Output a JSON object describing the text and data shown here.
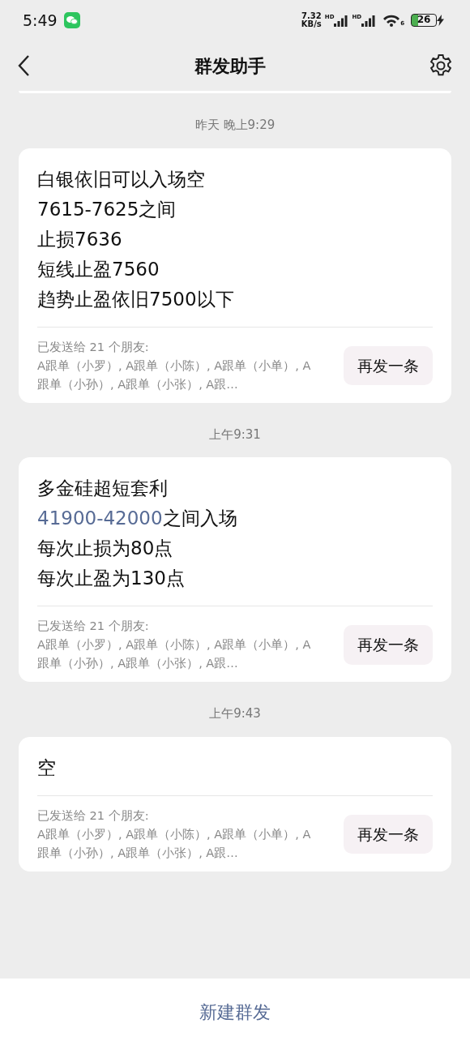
{
  "status_bar": {
    "time": "5:49",
    "speed_value": "7.32",
    "speed_unit": "KB/s",
    "sim_labels": [
      "HD",
      "HD"
    ],
    "wifi_label": "6",
    "battery": "26"
  },
  "header": {
    "title": "群发助手"
  },
  "messages": [
    {
      "time": "昨天 晚上9:29",
      "lines": [
        {
          "text": "白银依旧可以入场空"
        },
        {
          "text": "7615-7625之间"
        },
        {
          "text": "止损7636"
        },
        {
          "text": "短线止盈7560"
        },
        {
          "text": "趋势止盈依旧7500以下"
        }
      ],
      "sent_label": "已发送给 21 个朋友:",
      "recipients": "A跟单（小罗）, A跟单（小陈）, A跟单（小单）, A跟单（小孙）, A跟单（小张）, A跟…",
      "resend": "再发一条"
    },
    {
      "time": "上午9:31",
      "lines": [
        {
          "text": "多金硅超短套利"
        },
        {
          "link": "41900-42000",
          "text": "之间入场"
        },
        {
          "text": "每次止损为80点"
        },
        {
          "text": "每次止盈为130点"
        }
      ],
      "sent_label": "已发送给 21 个朋友:",
      "recipients": "A跟单（小罗）, A跟单（小陈）, A跟单（小单）, A跟单（小孙）, A跟单（小张）, A跟…",
      "resend": "再发一条"
    },
    {
      "time": "上午9:43",
      "lines": [
        {
          "text": "空"
        }
      ],
      "sent_label": "已发送给 21 个朋友:",
      "recipients": "A跟单（小罗）, A跟单（小陈）, A跟单（小单）, A跟单（小孙）, A跟单（小张）, A跟…",
      "resend": "再发一条"
    }
  ],
  "bottom_button": "新建群发"
}
